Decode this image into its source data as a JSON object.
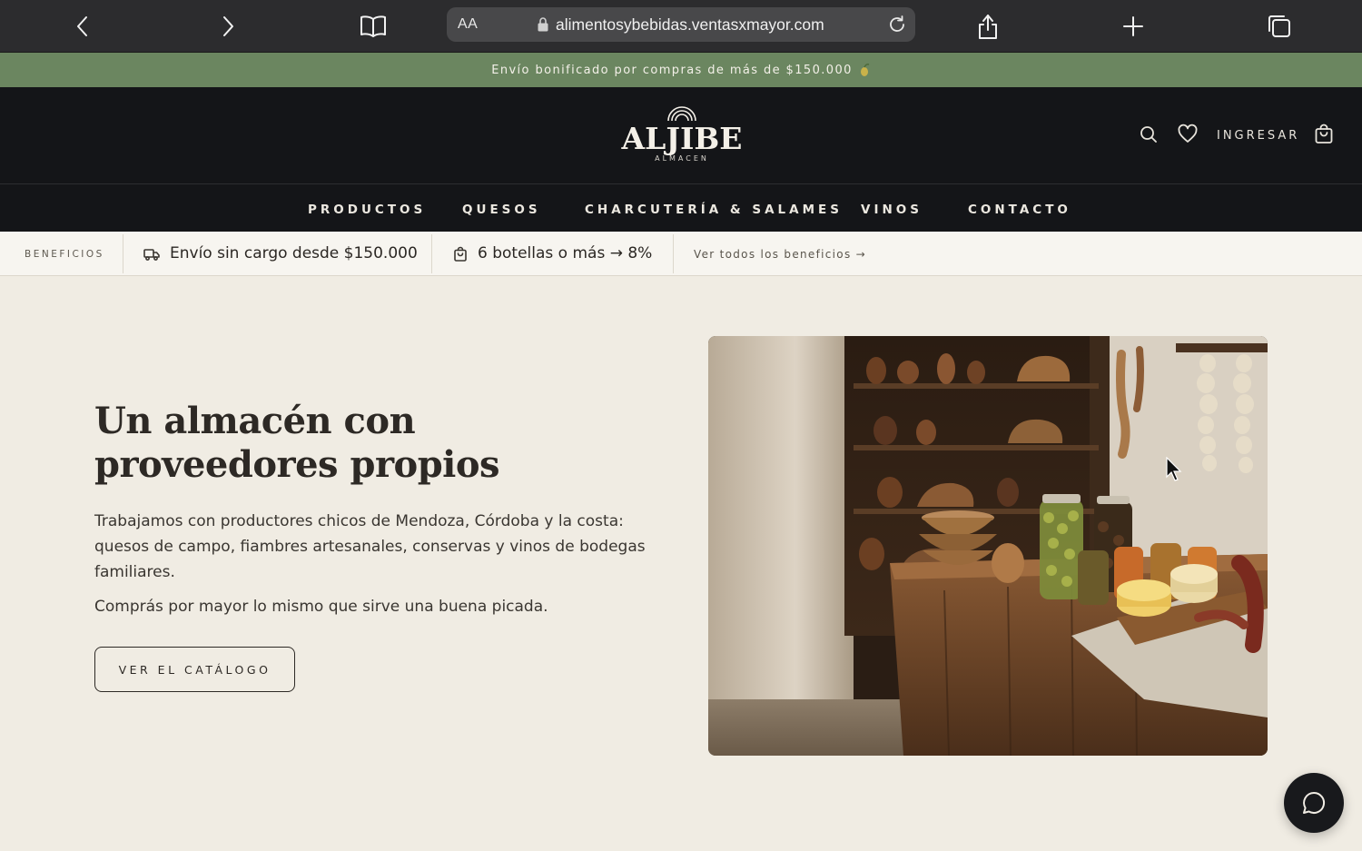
{
  "browser": {
    "text_size_label": "AA",
    "url": "alimentosybebidas.ventasxmayor.com",
    "icons": [
      "back-icon",
      "forward-icon",
      "bookmarks-icon",
      "lock-icon",
      "reload-icon",
      "share-icon",
      "new-tab-icon",
      "tabs-icon"
    ]
  },
  "announcement": {
    "text": "Envío bonificado por compras de más de $150.000",
    "icon": "olive-icon"
  },
  "header": {
    "logo_word": "ALJIBE",
    "logo_sub": "ALMACEN",
    "login_label": "INGRESAR",
    "icons": [
      "search-icon",
      "heart-icon",
      "cart-icon"
    ]
  },
  "nav": {
    "items": [
      {
        "label": "PRODUCTOS"
      },
      {
        "label": "QUESOS"
      },
      {
        "label": "CHARCUTERÍA & SALAMES"
      },
      {
        "label": "VINOS"
      },
      {
        "label": "CONTACTO"
      }
    ]
  },
  "benefits": {
    "label": "BENEFICIOS",
    "items": [
      {
        "icon": "truck-icon",
        "text": "Envío sin cargo desde $150.000"
      },
      {
        "icon": "bag-icon",
        "text": "6 botellas o más → 8%"
      }
    ],
    "link": "Ver todos los beneficios →"
  },
  "hero": {
    "title_line1": "Un almacén con",
    "title_line2": "proveedores propios",
    "paragraph1": "Trabajamos con productores chicos de Mendoza, Córdoba y la costa: quesos de campo, fiambres artesanales, conservas y vinos de bodegas familiares.",
    "paragraph2": "Comprás por mayor lo mismo que sirve una buena picada.",
    "cta_label": "VER EL CATÁLOGO",
    "image_subject": "rustic pantry with wooden counter, jars of olives, cheeses and hanging garlic"
  },
  "colors": {
    "announcement_bg": "#6b8660",
    "header_bg": "#141518",
    "page_bg": "#f0ece3",
    "text": "#2d2925"
  }
}
